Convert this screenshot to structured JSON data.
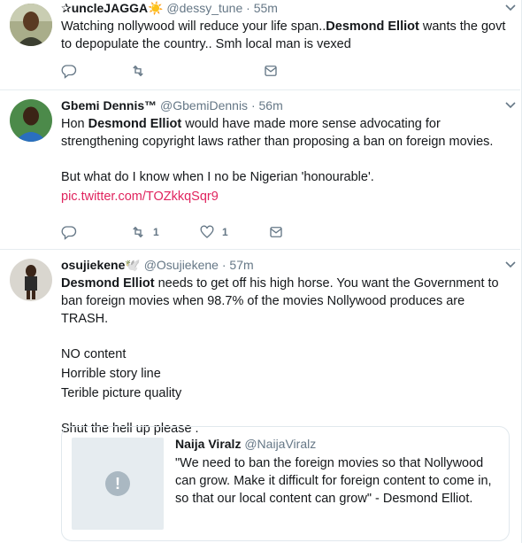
{
  "tweets": [
    {
      "name": "✰uncleJAGGA",
      "emoji": "☀️",
      "handle": "@dessy_tune",
      "time": "· 55m",
      "text": [
        {
          "t": "Watching nollywood  will reduce your life span.."
        },
        {
          "t": "Desmond Elliot",
          "b": true
        },
        {
          "t": " wants the govt to depopulate the country.. Smh local man is vexed"
        }
      ],
      "reply_count": "",
      "retweet_count": "",
      "like_count": ""
    },
    {
      "name": "Gbemi Dennis™",
      "handle": "@GbemiDennis",
      "time": "· 56m",
      "line1_pre": "Hon ",
      "line1_bold": "Desmond Elliot",
      "line1_post": " would have made more sense advocating for strengthening copyright laws rather than proposing a ban on foreign movies.",
      "line2": "But what do I know when I no be Nigerian 'honourable'.",
      "link": "pic.twitter.com/TOZkkqSqr9",
      "retweet_count": "1",
      "like_count": "1"
    },
    {
      "name": "osujiekene",
      "emoji": "🕊️",
      "handle": "@Osujiekene",
      "time": "· 57m",
      "line1_bold": "Desmond Elliot",
      "line1_post": " needs to get off his high horse.  You want the Government to ban foreign  movies when 98.7% of the movies Nollywood produces are TRASH.",
      "list": [
        "NO content",
        "Horrible story line",
        "Terible picture quality"
      ],
      "closing": "Shut the hell up please .",
      "quote": {
        "name": "Naija Viralz",
        "handle": "@NaijaViralz",
        "text": "\"We need to ban the foreign movies so that Nollywood can grow. Make it difficult for foreign content to come in, so that our local content can grow\" - Desmond Elliot."
      }
    }
  ],
  "colors": {
    "text": "#14171a",
    "secondary": "#657786",
    "link": "#e0245e",
    "border": "#e6ecf0"
  },
  "icons": [
    "reply-icon",
    "retweet-icon",
    "like-icon",
    "message-icon",
    "caret-down-icon",
    "broken-image-icon"
  ]
}
